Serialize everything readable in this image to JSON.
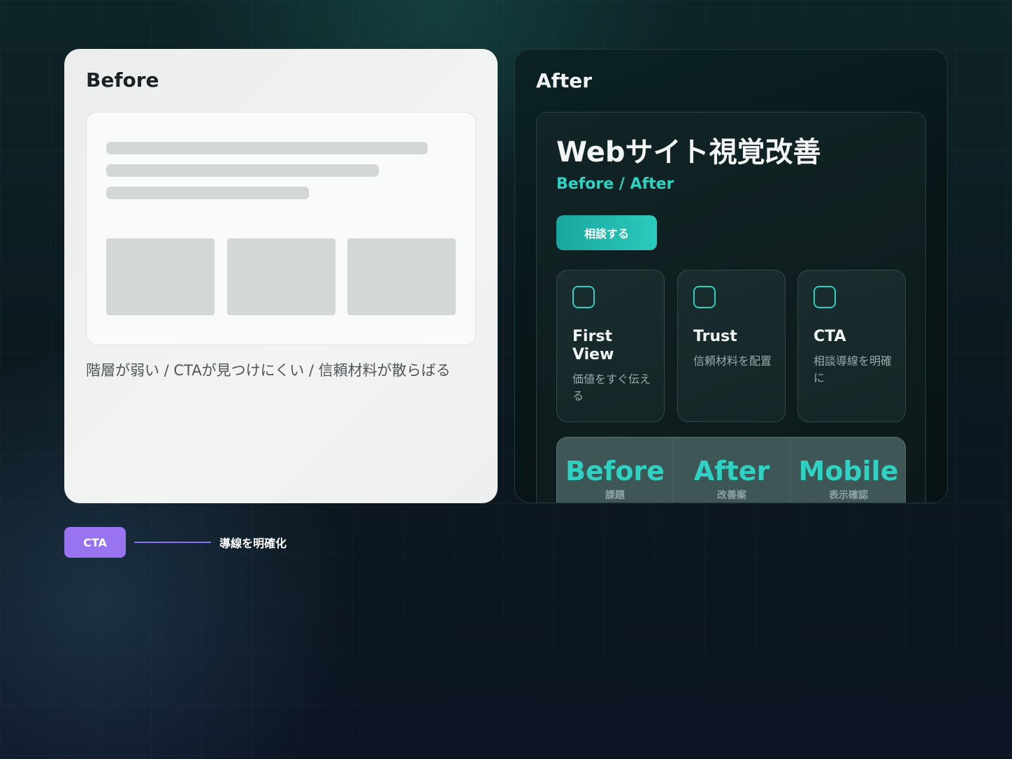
{
  "before": {
    "title": "Before",
    "caption": "階層が弱い / CTAが見つけにくい / 信頼材料が散らばる"
  },
  "after": {
    "title": "After",
    "hero_title": "Webサイト視覚改善",
    "hero_subtitle": "Before / After",
    "cta_label": "相談する",
    "cards": [
      {
        "title": "First View",
        "desc": "価値をすぐ伝える"
      },
      {
        "title": "Trust",
        "desc": "信頼材料を配置"
      },
      {
        "title": "CTA",
        "desc": "相談導線を明確に"
      }
    ],
    "stats": [
      {
        "value": "Before",
        "label": "課題"
      },
      {
        "value": "After",
        "label": "改善案"
      },
      {
        "value": "Mobile",
        "label": "表示確認"
      }
    ]
  },
  "annotation": {
    "badge": "CTA",
    "label": "導線を明確化"
  },
  "colors": {
    "accent_teal": "#2fd2c2",
    "annotation_purple": "#9874f0",
    "before_panel_bg": "#eff0f0",
    "after_panel_bg": "#081618"
  },
  "icons": [
    "square-outline-icon",
    "square-outline-icon",
    "square-outline-icon"
  ]
}
